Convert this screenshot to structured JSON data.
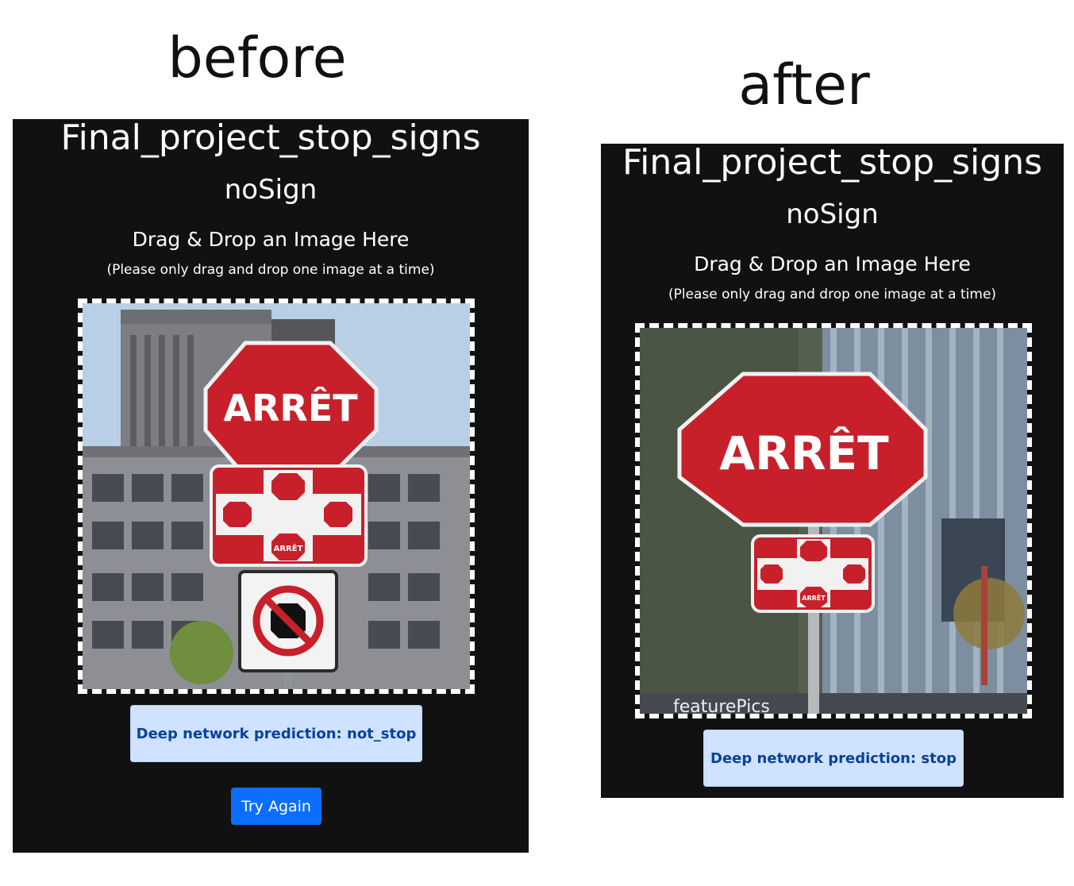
{
  "headings": {
    "before": "before",
    "after": "after"
  },
  "before": {
    "app_title": "Final_project_stop_signs",
    "status": "noSign",
    "drop_heading": "Drag & Drop an Image Here",
    "drop_note": "(Please only drag and drop one image at a time)",
    "image": {
      "sign_text": "ARRÊT",
      "small_sign_text": "ARRÊT"
    },
    "prediction": "Deep network prediction: not_stop",
    "try_again": "Try Again"
  },
  "after": {
    "app_title": "Final_project_stop_signs",
    "status": "noSign",
    "drop_heading": "Drag & Drop an Image Here",
    "drop_note": "(Please only drag and drop one image at a time)",
    "image": {
      "sign_text": "ARRÊT",
      "small_sign_text": "ARRÊT",
      "watermark": "featurePics"
    },
    "prediction": "Deep network prediction: stop"
  },
  "colors": {
    "panel_bg": "#111111",
    "stop_red": "#c8202b",
    "prediction_bg": "#cfe2ff",
    "prediction_text": "#084298",
    "button_blue": "#0d6efd"
  }
}
